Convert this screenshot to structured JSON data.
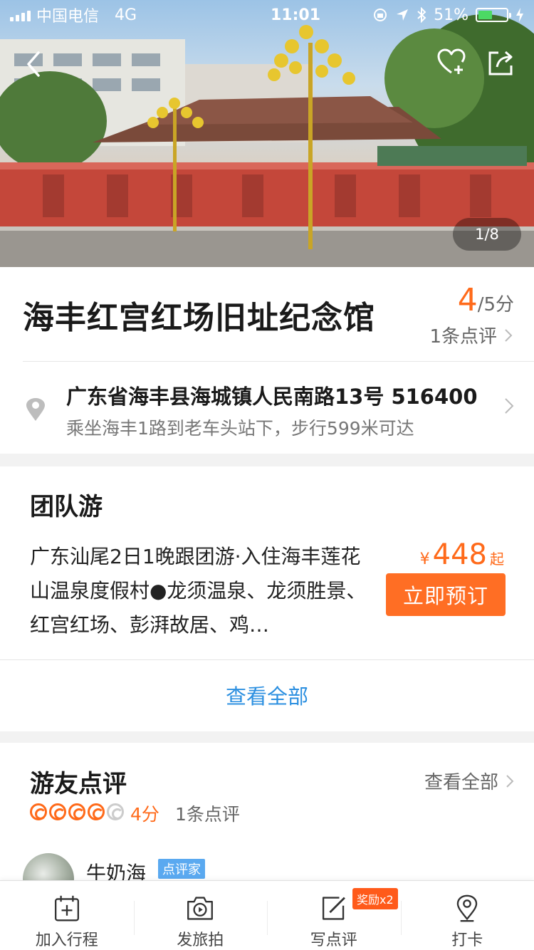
{
  "status_bar": {
    "carrier": "中国电信",
    "network": "4G",
    "time": "11:01",
    "battery": "51%",
    "battery_level": 0.51
  },
  "hero": {
    "counter": "1/8"
  },
  "header": {
    "title": "海丰红宫红场旧址纪念馆",
    "score_value": "4",
    "score_suffix": "/5分",
    "review_link": "1条点评"
  },
  "address": {
    "main": "广东省海丰县海城镇人民南路13号 516400",
    "sub": "乘坐海丰1路到老车头站下，步行599米可达"
  },
  "group_tour": {
    "title": "团队游",
    "description": "广东汕尾2日1晚跟团游·入住海丰莲花山温泉度假村●龙须温泉、龙须胜景、红宫红场、彭湃故居、鸡…",
    "price_currency": "¥",
    "price_amount": "448",
    "price_suffix": "起",
    "book_label": "立即预订",
    "view_all_label": "查看全部"
  },
  "reviews": {
    "title": "游友点评",
    "view_all_label": "查看全部",
    "rating": 4,
    "score_label": "4分",
    "count_label": "1条点评",
    "first_review": {
      "username": "牛奶海",
      "badge": "点评家"
    }
  },
  "tabbar": {
    "items": [
      {
        "label": "加入行程",
        "icon": "calendar-plus-icon"
      },
      {
        "label": "发旅拍",
        "icon": "camera-icon"
      },
      {
        "label": "写点评",
        "icon": "edit-icon",
        "badge": "奖励x2"
      },
      {
        "label": "打卡",
        "icon": "location-pin-icon"
      }
    ]
  },
  "colors": {
    "accent": "#ff6a1a",
    "link": "#2b8fe0",
    "badge_blue": "#5aa9f0"
  }
}
